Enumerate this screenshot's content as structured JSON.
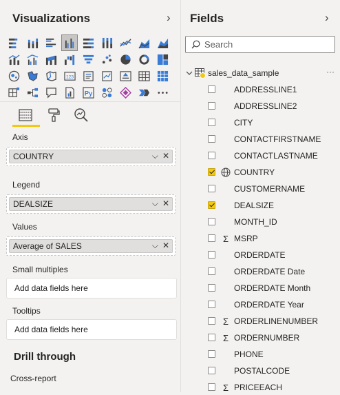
{
  "visualizations": {
    "title": "Visualizations",
    "collapse_glyph": "›",
    "icons": [
      [
        "stacked-bar-chart-icon",
        "stacked-column-chart-icon",
        "clustered-bar-chart-icon",
        "clustered-column-chart-icon",
        "100pct-stacked-bar-chart-icon",
        "100pct-stacked-column-chart-icon",
        "line-chart-icon",
        "area-chart-icon",
        "stacked-area-chart-icon"
      ],
      [
        "line-and-stacked-column-icon",
        "line-and-clustered-column-icon",
        "ribbon-chart-icon",
        "waterfall-chart-icon",
        "funnel-chart-icon",
        "scatter-chart-icon",
        "pie-chart-icon",
        "donut-chart-icon",
        "treemap-icon"
      ],
      [
        "map-icon",
        "filled-map-icon",
        "shape-map-icon",
        "gauge-icon",
        "card-icon",
        "multi-row-card-icon",
        "kpi-icon",
        "slicer-icon",
        "table-icon"
      ],
      [
        "matrix-icon",
        "decomposition-tree-icon",
        "qa-icon",
        "paginated-report-icon",
        "python-visual-icon",
        "key-influencers-icon",
        "power-apps-icon",
        "power-automate-icon",
        "more-visuals-icon"
      ]
    ],
    "selected_icon": "clustered-column-chart-icon",
    "tools": [
      "fields-well-icon",
      "format-paint-icon",
      "analytics-magnifier-icon"
    ],
    "wells": {
      "axis": {
        "label": "Axis",
        "value": "COUNTRY"
      },
      "legend": {
        "label": "Legend",
        "value": "DEALSIZE"
      },
      "values": {
        "label": "Values",
        "value": "Average of SALES"
      },
      "small_multiples": {
        "label": "Small multiples",
        "placeholder": "Add data fields here"
      },
      "tooltips": {
        "label": "Tooltips",
        "placeholder": "Add data fields here"
      }
    },
    "pill_expand_glyph": "⌵",
    "pill_remove_glyph": "✕",
    "drill_through_title": "Drill through",
    "cross_report_label": "Cross-report"
  },
  "fields": {
    "title": "Fields",
    "collapse_glyph": "›",
    "search_placeholder": "Search",
    "table_name": "sales_data_sample",
    "table_more": "···",
    "items": [
      {
        "name": "ADDRESSLINE1",
        "checked": false,
        "type": ""
      },
      {
        "name": "ADDRESSLINE2",
        "checked": false,
        "type": ""
      },
      {
        "name": "CITY",
        "checked": false,
        "type": ""
      },
      {
        "name": "CONTACTFIRSTNAME",
        "checked": false,
        "type": ""
      },
      {
        "name": "CONTACTLASTNAME",
        "checked": false,
        "type": ""
      },
      {
        "name": "COUNTRY",
        "checked": true,
        "type": "globe"
      },
      {
        "name": "CUSTOMERNAME",
        "checked": false,
        "type": ""
      },
      {
        "name": "DEALSIZE",
        "checked": true,
        "type": ""
      },
      {
        "name": "MONTH_ID",
        "checked": false,
        "type": ""
      },
      {
        "name": "MSRP",
        "checked": false,
        "type": "sigma"
      },
      {
        "name": "ORDERDATE",
        "checked": false,
        "type": ""
      },
      {
        "name": "ORDERDATE Date",
        "checked": false,
        "type": ""
      },
      {
        "name": "ORDERDATE Month",
        "checked": false,
        "type": ""
      },
      {
        "name": "ORDERDATE Year",
        "checked": false,
        "type": ""
      },
      {
        "name": "ORDERLINENUMBER",
        "checked": false,
        "type": "sigma"
      },
      {
        "name": "ORDERNUMBER",
        "checked": false,
        "type": "sigma"
      },
      {
        "name": "PHONE",
        "checked": false,
        "type": ""
      },
      {
        "name": "POSTALCODE",
        "checked": false,
        "type": ""
      },
      {
        "name": "PRICEEACH",
        "checked": false,
        "type": "sigma"
      }
    ]
  },
  "colors": {
    "accent": "#f2c811",
    "icon_blue": "#3a7bd5",
    "icon_dark": "#444444"
  }
}
